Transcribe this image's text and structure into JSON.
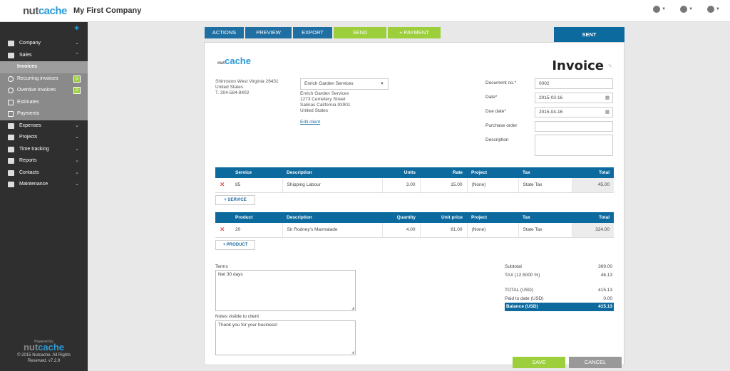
{
  "app": {
    "logo_left": "nut",
    "logo_right": "cache",
    "company_name": "My First Company"
  },
  "topbar": {
    "icons": [
      "globe-icon",
      "help-icon",
      "user-icon"
    ]
  },
  "sidebar": {
    "items": [
      {
        "label": "Company",
        "icon": "company-icon",
        "chevron": "⌄"
      },
      {
        "label": "Sales",
        "icon": "sales-icon",
        "chevron": "⌃"
      },
      {
        "label": "Expenses",
        "icon": "expenses-icon",
        "chevron": "⌄"
      },
      {
        "label": "Projects",
        "icon": "projects-icon",
        "chevron": "⌄"
      },
      {
        "label": "Time tracking",
        "icon": "time-icon",
        "chevron": "⌄"
      },
      {
        "label": "Reports",
        "icon": "reports-icon",
        "chevron": "⌄"
      },
      {
        "label": "Contacts",
        "icon": "contacts-icon",
        "chevron": "⌄"
      },
      {
        "label": "Maintenance",
        "icon": "maintenance-icon",
        "chevron": "⌄"
      }
    ],
    "sales_sub": [
      {
        "label": "Invoices",
        "active": true
      },
      {
        "label": "Recurring invoices",
        "badge": "P"
      },
      {
        "label": "Overdue invoices",
        "badge": "P"
      },
      {
        "label": "Estimates"
      },
      {
        "label": "Payments"
      }
    ],
    "footer": {
      "powered_by": "Powered by",
      "logo_left": "nut",
      "logo_right": "cache",
      "copyright": "© 2015 Nutcache. All Rights Reserved. v7.2.9"
    }
  },
  "toolbar": {
    "actions": "ACTIONS",
    "preview": "PREVIEW",
    "export": "EXPORT",
    "send": "SEND",
    "payment": "+ PAYMENT",
    "status": "SENT"
  },
  "invoice": {
    "title": "Invoice",
    "from": {
      "line1": "Shinnston West Virginia 26431",
      "line2": "United States",
      "line3": "T. 304-584-8402"
    },
    "client": {
      "selected": "Enrich Garden Services",
      "addr1": "Enrich Garden Services",
      "addr2": "1273 Cemetery Street",
      "addr3": "Salinas California 93901",
      "addr4": "United States",
      "edit_link": "Edit client"
    },
    "fields": {
      "doc_no_label": "Document no.*",
      "doc_no": "0002",
      "date_label": "Date*",
      "date": "2015-03-16",
      "due_label": "Due date*",
      "due": "2015-04-16",
      "po_label": "Purchase order",
      "po": "",
      "desc_label": "Description",
      "desc": ""
    },
    "services": {
      "headers": [
        "Service",
        "Description",
        "Units",
        "Rate",
        "Project",
        "Tax",
        "Total"
      ],
      "rows": [
        {
          "code": "85",
          "desc": "Shipping Labour",
          "units": "3.00",
          "rate": "15.00",
          "project": "(None)",
          "tax": "State Tax",
          "total": "45.00"
        }
      ],
      "add_label": "+ SERVICE"
    },
    "products": {
      "headers": [
        "Product",
        "Description",
        "Quantity",
        "Unit price",
        "Project",
        "Tax",
        "Total"
      ],
      "rows": [
        {
          "code": "20",
          "desc": "Sir Rodney's Marmalade",
          "qty": "4.00",
          "price": "81.00",
          "project": "(None)",
          "tax": "State Tax",
          "total": "324.00"
        }
      ],
      "add_label": "+ PRODUCT"
    },
    "terms_label": "Terms",
    "terms": "Net 30 days",
    "notes_label": "Notes visible to client",
    "notes": "Thank you for your business!",
    "summary": {
      "subtotal_label": "Subtotal",
      "subtotal": "369.00",
      "tax_label": "TAX (12.5000 %)",
      "tax": "46.13",
      "total_label": "TOTAL (USD)",
      "total": "415.13",
      "paid_label": "Paid to date (USD)",
      "paid": "0.00",
      "balance_label": "Balance (USD)",
      "balance": "415.13"
    }
  },
  "footer_buttons": {
    "save": "SAVE",
    "cancel": "CANCEL"
  }
}
